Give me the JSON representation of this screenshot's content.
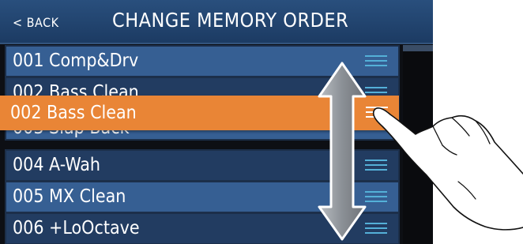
{
  "header": {
    "back_label": "< BACK",
    "title": "CHANGE MEMORY ORDER"
  },
  "list": {
    "rows": [
      {
        "label": "001 Comp&Drv"
      },
      {
        "label": "002 Bass Clean"
      },
      {
        "label": "003 Slap Back"
      },
      {
        "label": "004 A-Wah"
      },
      {
        "label": "005 MX Clean"
      },
      {
        "label": "006 +LoOctave"
      }
    ]
  },
  "dragging": {
    "label": "002 Bass Clean"
  },
  "colors": {
    "title_bar": "#1c3b63",
    "row_light": "#365f93",
    "row_dark": "#223c61",
    "highlight": "#e98536",
    "handle": "#54b0d8"
  },
  "icons": {
    "reorder_handle": "drag-handle-icon",
    "vertical_arrow": "up-down-arrow-icon",
    "pointing_hand": "pointing-hand-icon"
  }
}
